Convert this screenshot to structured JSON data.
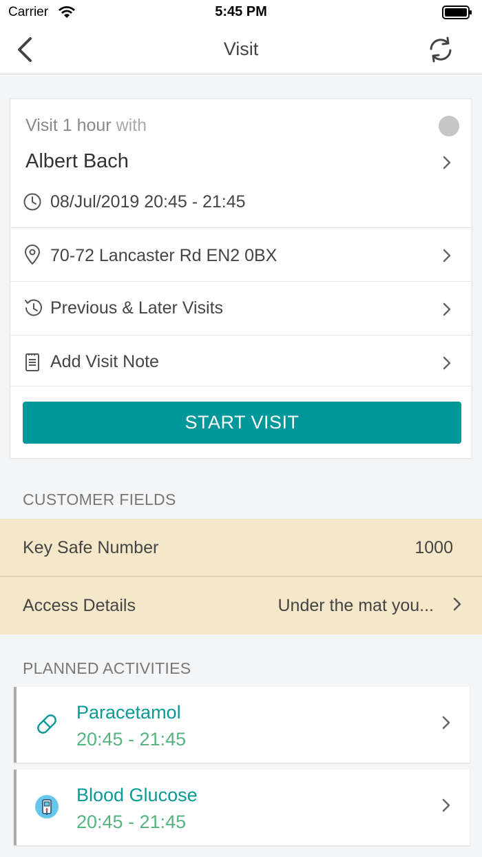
{
  "status_bar": {
    "carrier": "Carrier",
    "time": "5:45 PM"
  },
  "nav": {
    "title": "Visit"
  },
  "visit": {
    "header_prefix": "Visit 1 hour",
    "header_suffix": "with",
    "client_name": "Albert Bach",
    "schedule": "08/Jul/2019  20:45 - 21:45",
    "address": "70-72 Lancaster Rd  EN2 0BX",
    "previous_later_label": "Previous & Later Visits",
    "add_note_label": "Add Visit Note",
    "start_button_label": "START VISIT"
  },
  "customer_fields": {
    "header": "CUSTOMER FIELDS",
    "items": [
      {
        "label": "Key Safe Number",
        "value": "1000"
      },
      {
        "label": "Access Details",
        "value": "Under the mat you..."
      }
    ]
  },
  "planned_activities": {
    "header": "PLANNED ACTIVITIES",
    "items": [
      {
        "title": "Paracetamol",
        "time": "20:45 - 21:45",
        "icon": "pill-icon"
      },
      {
        "title": "Blood Glucose",
        "time": "20:45 - 21:45",
        "icon": "glucose-meter-icon"
      }
    ]
  },
  "colors": {
    "accent": "#00979a",
    "activity_title": "#0a9a96",
    "activity_time": "#55b57f",
    "customer_field_bg": "#f5e7c9"
  }
}
